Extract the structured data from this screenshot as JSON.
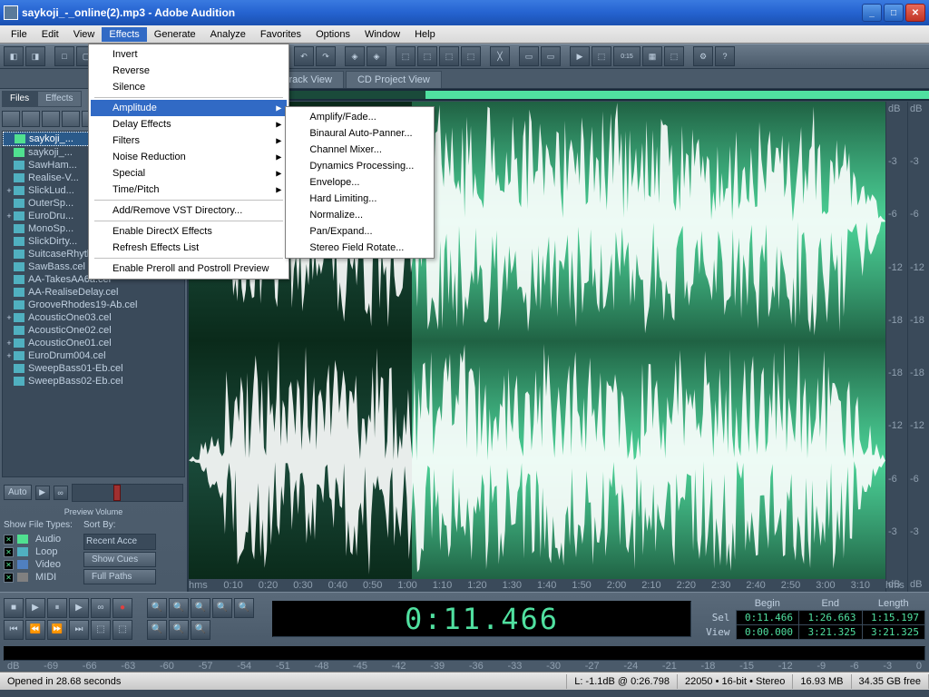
{
  "title": "saykoji_-_online(2).mp3 - Adobe Audition",
  "menubar": [
    "File",
    "Edit",
    "View",
    "Effects",
    "Generate",
    "Analyze",
    "Favorites",
    "Options",
    "Window",
    "Help"
  ],
  "active_menu_index": 3,
  "effects_menu": {
    "group1": [
      "Invert",
      "Reverse",
      "Silence"
    ],
    "group2": [
      "Amplitude",
      "Delay Effects",
      "Filters",
      "Noise Reduction",
      "Special",
      "Time/Pitch"
    ],
    "group3": [
      "Add/Remove VST Directory..."
    ],
    "group4": [
      "Enable DirectX Effects",
      "Refresh Effects List"
    ],
    "group5": [
      "Enable Preroll and Postroll Preview"
    ],
    "highlighted": "Amplitude"
  },
  "amplitude_submenu": [
    "Amplify/Fade...",
    "Binaural Auto-Panner...",
    "Channel Mixer...",
    "Dynamics Processing...",
    "Envelope...",
    "Hard Limiting...",
    "Normalize...",
    "Pan/Expand...",
    "Stereo Field Rotate..."
  ],
  "view_tabs": [
    "itrack View",
    "CD Project View"
  ],
  "left_panel": {
    "tabs": [
      "Files",
      "Effects"
    ],
    "files": [
      {
        "name": "saykoji_...",
        "expand": "",
        "icon": "green",
        "selected": true
      },
      {
        "name": "saykoji_...",
        "expand": "",
        "icon": "green"
      },
      {
        "name": "SawHam...",
        "expand": "",
        "icon": "teal"
      },
      {
        "name": "Realise-V...",
        "expand": "",
        "icon": "teal"
      },
      {
        "name": "SlickLud...",
        "expand": "+",
        "icon": "teal"
      },
      {
        "name": "OuterSp...",
        "expand": "",
        "icon": "teal"
      },
      {
        "name": "EuroDru...",
        "expand": "+",
        "icon": "teal"
      },
      {
        "name": "MonoSp...",
        "expand": "",
        "icon": "teal"
      },
      {
        "name": "SlickDirty...",
        "expand": "",
        "icon": "teal"
      },
      {
        "name": "SuitcaseRhythmBody.cel",
        "expand": "",
        "icon": "teal"
      },
      {
        "name": "SawBass.cel",
        "expand": "",
        "icon": "teal"
      },
      {
        "name": "AA-TakesAA6a.cel",
        "expand": "",
        "icon": "teal"
      },
      {
        "name": "AA-RealiseDelay.cel",
        "expand": "",
        "icon": "teal"
      },
      {
        "name": "GrooveRhodes19-Ab.cel",
        "expand": "",
        "icon": "teal"
      },
      {
        "name": "AcousticOne03.cel",
        "expand": "+",
        "icon": "teal"
      },
      {
        "name": "AcousticOne02.cel",
        "expand": "",
        "icon": "teal"
      },
      {
        "name": "AcousticOne01.cel",
        "expand": "+",
        "icon": "teal"
      },
      {
        "name": "EuroDrum004.cel",
        "expand": "+",
        "icon": "teal"
      },
      {
        "name": "SweepBass01-Eb.cel",
        "expand": "",
        "icon": "teal"
      },
      {
        "name": "SweepBass02-Eb.cel",
        "expand": "",
        "icon": "teal"
      }
    ],
    "auto_label": "Auto",
    "preview_label": "Preview Volume",
    "show_types_label": "Show File Types:",
    "sort_label": "Sort By:",
    "sort_value": "Recent Acce",
    "types": [
      "Audio",
      "Loop",
      "Video",
      "MIDI"
    ],
    "show_cues": "Show Cues",
    "full_paths": "Full Paths"
  },
  "db_scale": [
    "dB",
    "-3",
    "-6",
    "-12",
    "-18",
    "-18",
    "-12",
    "-6",
    "-3",
    "dB"
  ],
  "time_ticks": [
    "hms",
    "0:10",
    "0:20",
    "0:30",
    "0:40",
    "0:50",
    "1:00",
    "1:10",
    "1:20",
    "1:30",
    "1:40",
    "1:50",
    "2:00",
    "2:10",
    "2:20",
    "2:30",
    "2:40",
    "2:50",
    "3:00",
    "3:10",
    "hms"
  ],
  "time_display": "0:11.466",
  "selection": {
    "headers": [
      "Begin",
      "End",
      "Length"
    ],
    "sel_label": "Sel",
    "view_label": "View",
    "sel": [
      "0:11.466",
      "1:26.663",
      "1:15.197"
    ],
    "view": [
      "0:00.000",
      "3:21.325",
      "3:21.325"
    ]
  },
  "level_ticks": [
    "dB",
    "-69",
    "-66",
    "-63",
    "-60",
    "-57",
    "-54",
    "-51",
    "-48",
    "-45",
    "-42",
    "-39",
    "-36",
    "-33",
    "-30",
    "-27",
    "-24",
    "-21",
    "-18",
    "-15",
    "-12",
    "-9",
    "-6",
    "-3",
    "0"
  ],
  "status": {
    "opened": "Opened in 28.68 seconds",
    "level": "L: -1.1dB @ 0:26.798",
    "sr": "22050 • 16-bit • Stereo",
    "size": "16.93 MB",
    "free": "34.35 GB free"
  }
}
